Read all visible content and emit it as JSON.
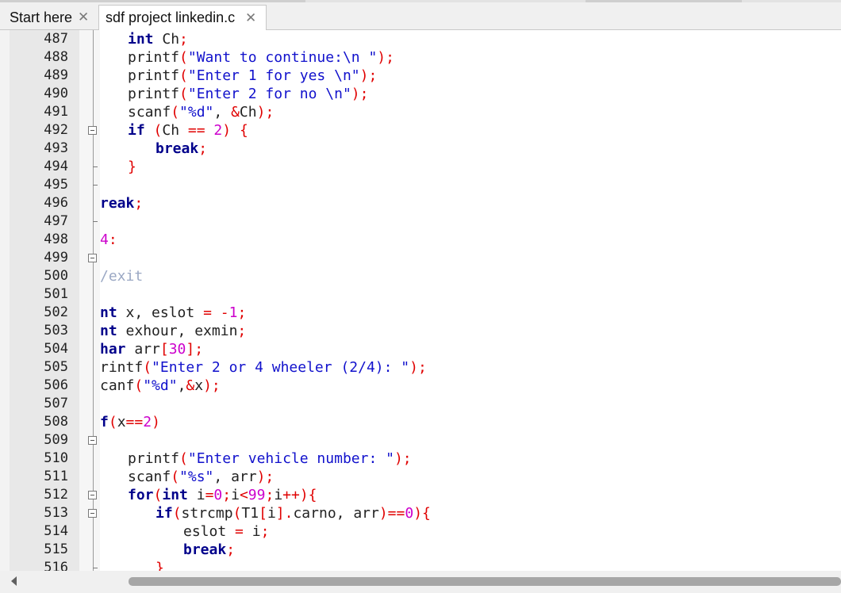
{
  "tabs": [
    {
      "label": "Start here",
      "close_icon": "close-icon"
    },
    {
      "label": "sdf project linkedin.c",
      "close_icon": "close-icon",
      "active": true
    }
  ],
  "colors": {
    "keyword": "#00008b",
    "string": "#1111cc",
    "operator": "#e00000",
    "number": "#cc00cc",
    "comment": "#9ba8c4"
  },
  "lines": [
    {
      "num": "487",
      "indent": 1,
      "fold": "none",
      "tokens": [
        [
          "kw",
          "int"
        ],
        [
          "id",
          " Ch"
        ],
        [
          "op",
          ";"
        ]
      ]
    },
    {
      "num": "488",
      "indent": 1,
      "fold": "none",
      "tokens": [
        [
          "id",
          "printf"
        ],
        [
          "op",
          "("
        ],
        [
          "str",
          "\"Want to continue:\\n \""
        ],
        [
          "op",
          ");"
        ]
      ]
    },
    {
      "num": "489",
      "indent": 1,
      "fold": "none",
      "tokens": [
        [
          "id",
          "printf"
        ],
        [
          "op",
          "("
        ],
        [
          "str",
          "\"Enter 1 for yes \\n\""
        ],
        [
          "op",
          ");"
        ]
      ]
    },
    {
      "num": "490",
      "indent": 1,
      "fold": "none",
      "tokens": [
        [
          "id",
          "printf"
        ],
        [
          "op",
          "("
        ],
        [
          "str",
          "\"Enter 2 for no \\n\""
        ],
        [
          "op",
          ");"
        ]
      ]
    },
    {
      "num": "491",
      "indent": 1,
      "fold": "none",
      "tokens": [
        [
          "id",
          "scanf"
        ],
        [
          "op",
          "("
        ],
        [
          "str",
          "\"%d\""
        ],
        [
          "id",
          ", "
        ],
        [
          "op",
          "&"
        ],
        [
          "id",
          "Ch"
        ],
        [
          "op",
          ");"
        ]
      ]
    },
    {
      "num": "492",
      "indent": 1,
      "fold": "box",
      "tokens": [
        [
          "kw",
          "if"
        ],
        [
          "id",
          " "
        ],
        [
          "op",
          "("
        ],
        [
          "id",
          "Ch "
        ],
        [
          "op",
          "=="
        ],
        [
          "id",
          " "
        ],
        [
          "num",
          "2"
        ],
        [
          "op",
          ")"
        ],
        [
          "id",
          " "
        ],
        [
          "op",
          "{"
        ]
      ]
    },
    {
      "num": "493",
      "indent": 2,
      "fold": "none",
      "tokens": [
        [
          "kw",
          "break"
        ],
        [
          "op",
          ";"
        ]
      ]
    },
    {
      "num": "494",
      "indent": 1,
      "fold": "tick",
      "tokens": [
        [
          "op",
          "}"
        ]
      ]
    },
    {
      "num": "495",
      "indent": 0,
      "fold": "tick",
      "tokens": []
    },
    {
      "num": "496",
      "indent": 0,
      "fold": "none",
      "tokens": [
        [
          "kw",
          "reak"
        ],
        [
          "op",
          ";"
        ]
      ]
    },
    {
      "num": "497",
      "indent": 0,
      "fold": "tick",
      "tokens": []
    },
    {
      "num": "498",
      "indent": 0,
      "fold": "none",
      "tokens": [
        [
          "num",
          "4"
        ],
        [
          "op",
          ":"
        ]
      ]
    },
    {
      "num": "499",
      "indent": 0,
      "fold": "box",
      "tokens": []
    },
    {
      "num": "500",
      "indent": 0,
      "fold": "none",
      "tokens": [
        [
          "cmt",
          "/exit"
        ]
      ]
    },
    {
      "num": "501",
      "indent": 0,
      "fold": "none",
      "tokens": []
    },
    {
      "num": "502",
      "indent": 0,
      "fold": "none",
      "tokens": [
        [
          "kw",
          "nt"
        ],
        [
          "id",
          " x, eslot "
        ],
        [
          "op",
          "="
        ],
        [
          "id",
          " "
        ],
        [
          "op",
          "-"
        ],
        [
          "num",
          "1"
        ],
        [
          "op",
          ";"
        ]
      ]
    },
    {
      "num": "503",
      "indent": 0,
      "fold": "none",
      "tokens": [
        [
          "kw",
          "nt"
        ],
        [
          "id",
          " exhour, exmin"
        ],
        [
          "op",
          ";"
        ]
      ]
    },
    {
      "num": "504",
      "indent": 0,
      "fold": "none",
      "tokens": [
        [
          "kw",
          "har"
        ],
        [
          "id",
          " arr"
        ],
        [
          "op",
          "["
        ],
        [
          "num",
          "30"
        ],
        [
          "op",
          "];"
        ]
      ]
    },
    {
      "num": "505",
      "indent": 0,
      "fold": "none",
      "tokens": [
        [
          "id",
          "rintf"
        ],
        [
          "op",
          "("
        ],
        [
          "str",
          "\"Enter 2 or 4 wheeler (2/4): \""
        ],
        [
          "op",
          ");"
        ]
      ]
    },
    {
      "num": "506",
      "indent": 0,
      "fold": "none",
      "tokens": [
        [
          "id",
          "canf"
        ],
        [
          "op",
          "("
        ],
        [
          "str",
          "\"%d\""
        ],
        [
          "id",
          ","
        ],
        [
          "op",
          "&"
        ],
        [
          "id",
          "x"
        ],
        [
          "op",
          ");"
        ]
      ]
    },
    {
      "num": "507",
      "indent": 0,
      "fold": "none",
      "tokens": []
    },
    {
      "num": "508",
      "indent": 0,
      "fold": "none",
      "tokens": [
        [
          "kw",
          "f"
        ],
        [
          "op",
          "("
        ],
        [
          "id",
          "x"
        ],
        [
          "op",
          "=="
        ],
        [
          "num",
          "2"
        ],
        [
          "op",
          ")"
        ]
      ]
    },
    {
      "num": "509",
      "indent": 0,
      "fold": "box",
      "tokens": []
    },
    {
      "num": "510",
      "indent": 1,
      "fold": "none",
      "tokens": [
        [
          "id",
          "printf"
        ],
        [
          "op",
          "("
        ],
        [
          "str",
          "\"Enter vehicle number: \""
        ],
        [
          "op",
          ");"
        ]
      ]
    },
    {
      "num": "511",
      "indent": 1,
      "fold": "none",
      "tokens": [
        [
          "id",
          "scanf"
        ],
        [
          "op",
          "("
        ],
        [
          "str",
          "\"%s\""
        ],
        [
          "id",
          ", arr"
        ],
        [
          "op",
          ");"
        ]
      ]
    },
    {
      "num": "512",
      "indent": 1,
      "fold": "box",
      "tokens": [
        [
          "kw",
          "for"
        ],
        [
          "op",
          "("
        ],
        [
          "kw",
          "int"
        ],
        [
          "id",
          " i"
        ],
        [
          "op",
          "="
        ],
        [
          "num",
          "0"
        ],
        [
          "op",
          ";"
        ],
        [
          "id",
          "i"
        ],
        [
          "op",
          "<"
        ],
        [
          "num",
          "99"
        ],
        [
          "op",
          ";"
        ],
        [
          "id",
          "i"
        ],
        [
          "op",
          "++){"
        ]
      ]
    },
    {
      "num": "513",
      "indent": 2,
      "fold": "box",
      "tokens": [
        [
          "kw",
          "if"
        ],
        [
          "op",
          "("
        ],
        [
          "id",
          "strcmp"
        ],
        [
          "op",
          "("
        ],
        [
          "id",
          "T1"
        ],
        [
          "op",
          "["
        ],
        [
          "id",
          "i"
        ],
        [
          "op",
          "]."
        ],
        [
          "id",
          "carno, arr"
        ],
        [
          "op",
          ")=="
        ],
        [
          "num",
          "0"
        ],
        [
          "op",
          "){"
        ]
      ]
    },
    {
      "num": "514",
      "indent": 3,
      "fold": "none",
      "tokens": [
        [
          "id",
          "eslot "
        ],
        [
          "op",
          "="
        ],
        [
          "id",
          " i"
        ],
        [
          "op",
          ";"
        ]
      ]
    },
    {
      "num": "515",
      "indent": 3,
      "fold": "none",
      "tokens": [
        [
          "kw",
          "break"
        ],
        [
          "op",
          ";"
        ]
      ]
    },
    {
      "num": "516",
      "indent": 2,
      "fold": "tick",
      "tokens": [
        [
          "op",
          "}"
        ]
      ]
    }
  ],
  "scrollbar": {
    "left_arrow_icon": "chevron-left-icon"
  }
}
